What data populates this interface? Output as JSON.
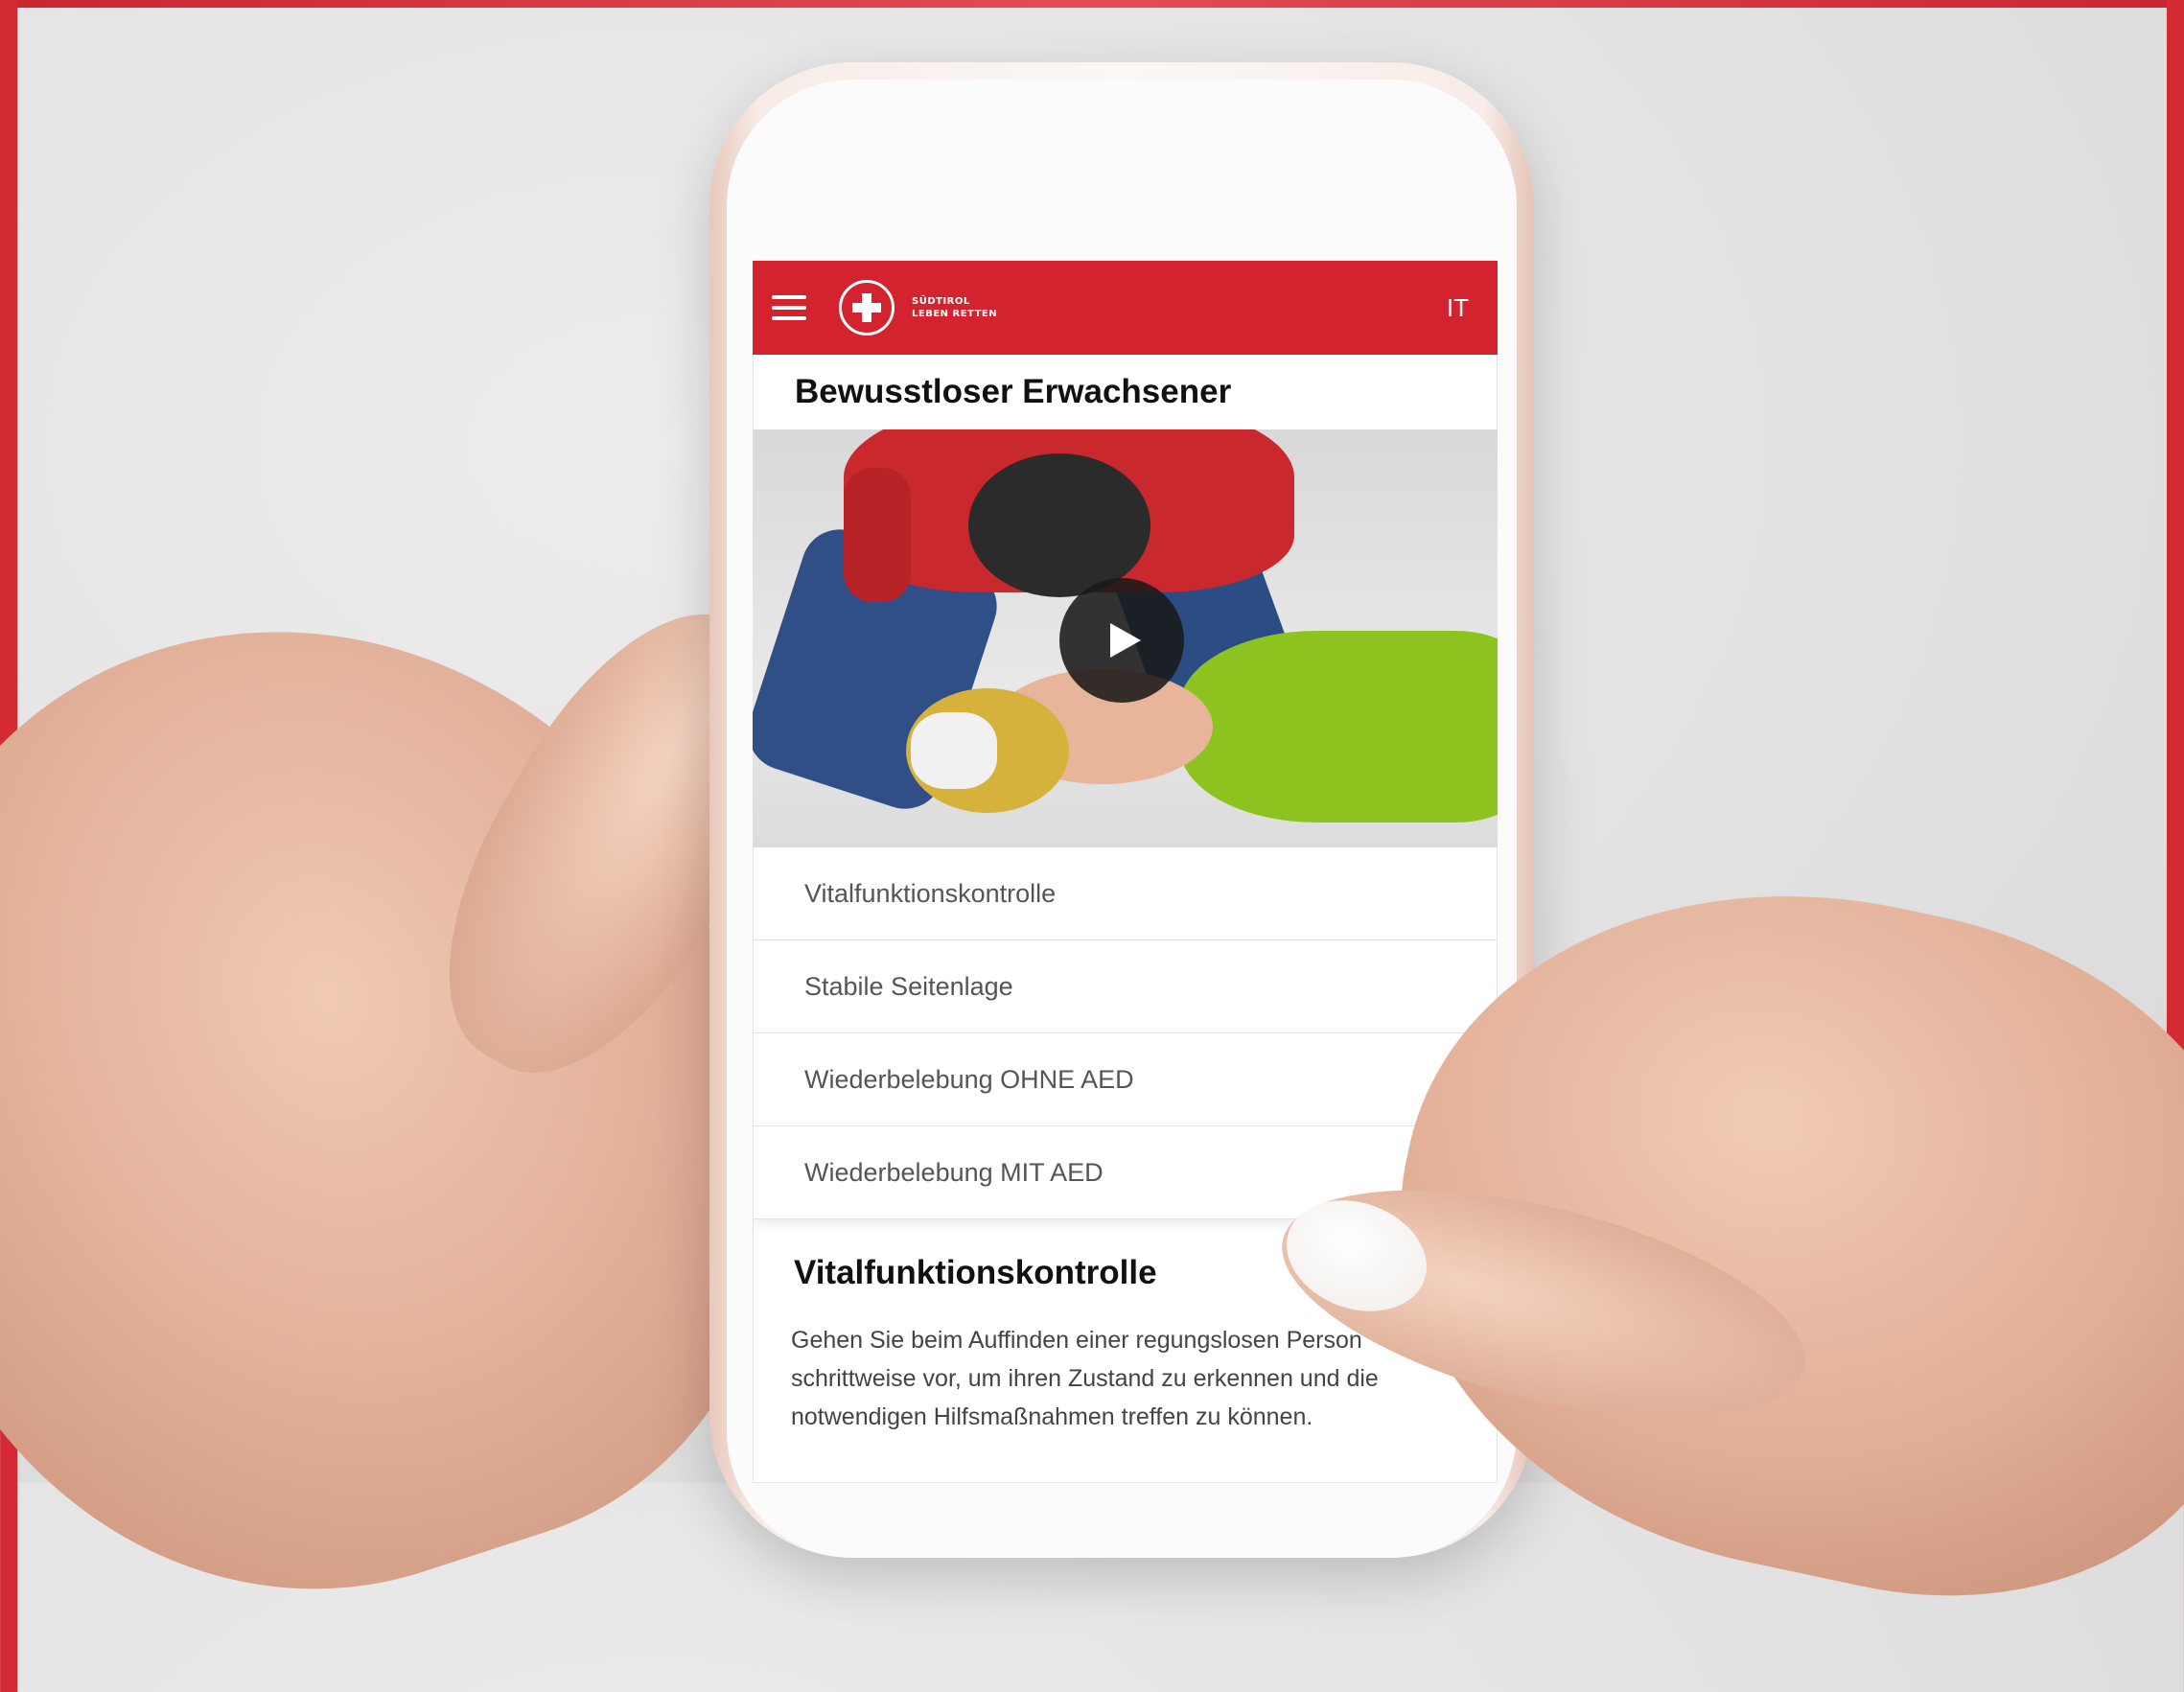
{
  "header": {
    "brand_line1": "SÜDTIROL",
    "brand_line2": "LEBEN RETTEN",
    "language": "IT",
    "menu_icon": "hamburger-icon",
    "logo_icon": "white-cross-logo"
  },
  "page": {
    "title": "Bewusstloser Erwachsener"
  },
  "video": {
    "play_icon": "play-icon"
  },
  "menu": {
    "items": [
      {
        "label": "Vitalfunktionskontrolle"
      },
      {
        "label": "Stabile Seitenlage"
      },
      {
        "label": "Wiederbelebung OHNE AED"
      },
      {
        "label": "Wiederbelebung MIT AED"
      }
    ]
  },
  "section": {
    "title": "Vitalfunktionskontrolle",
    "text": "Gehen Sie beim Auffinden einer regungslosen Person schrittweise vor, um ihren Zustand zu erkennen und die notwendigen Hilfsmaßnahmen treffen zu können."
  },
  "colors": {
    "brand_red": "#d2232e",
    "patient_green": "#8cc31f"
  }
}
